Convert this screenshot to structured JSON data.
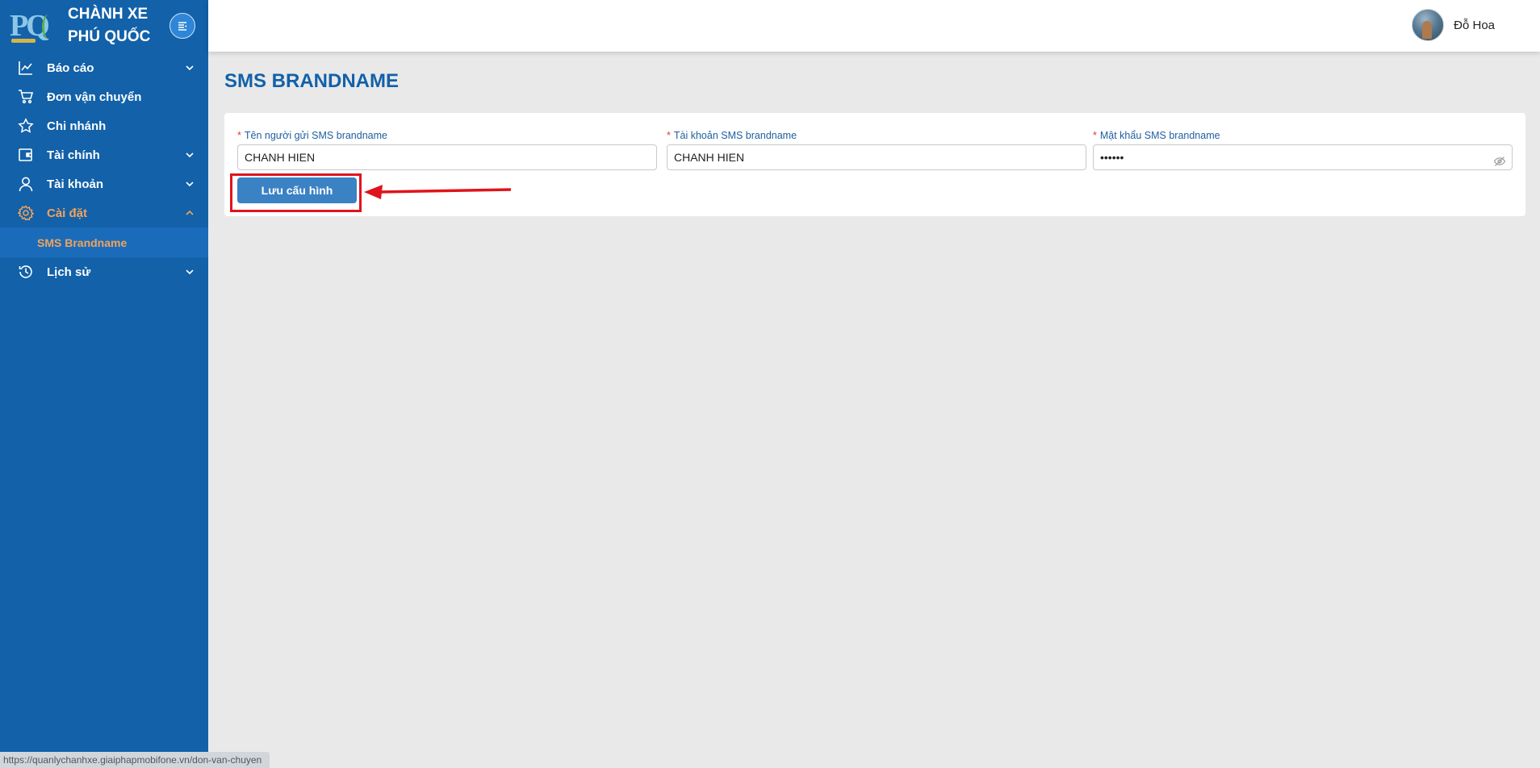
{
  "brand": {
    "title": "CHÀNH XE PHÚ QUỐC"
  },
  "sidebar": {
    "items": [
      {
        "label": "Báo cáo",
        "icon": "chart-line-icon",
        "expandable": true
      },
      {
        "label": "Đơn vận chuyển",
        "icon": "cart-icon",
        "expandable": false
      },
      {
        "label": "Chi nhánh",
        "icon": "star-icon",
        "expandable": false
      },
      {
        "label": "Tài chính",
        "icon": "wallet-icon",
        "expandable": true
      },
      {
        "label": "Tài khoản",
        "icon": "user-icon",
        "expandable": true
      },
      {
        "label": "Cài đặt",
        "icon": "gear-icon",
        "expandable": true,
        "expanded": true,
        "active": true
      },
      {
        "label": "Lịch sử",
        "icon": "clock-icon",
        "expandable": true
      }
    ],
    "submenu": {
      "label": "SMS Brandname"
    }
  },
  "header": {
    "username": "Đỗ Hoa"
  },
  "page": {
    "title": "SMS BRANDNAME"
  },
  "form": {
    "required_mark": "*",
    "sender_name": {
      "label": "Tên người gửi SMS brandname",
      "value": "CHANH HIEN"
    },
    "account": {
      "label": "Tài khoản SMS brandname",
      "value": "CHANH HIEN"
    },
    "password": {
      "label": "Mật khẩu SMS brandname",
      "value": "••••••"
    },
    "save_label": "Lưu cấu hình"
  },
  "status_bar": {
    "url": "https://quanlychanhxe.giaiphapmobifone.vn/don-van-chuyen"
  },
  "colors": {
    "sidebar_bg": "#1261a9",
    "accent": "#f2a35b",
    "primary_button": "#3a82c4",
    "annotation": "#e0141c"
  }
}
